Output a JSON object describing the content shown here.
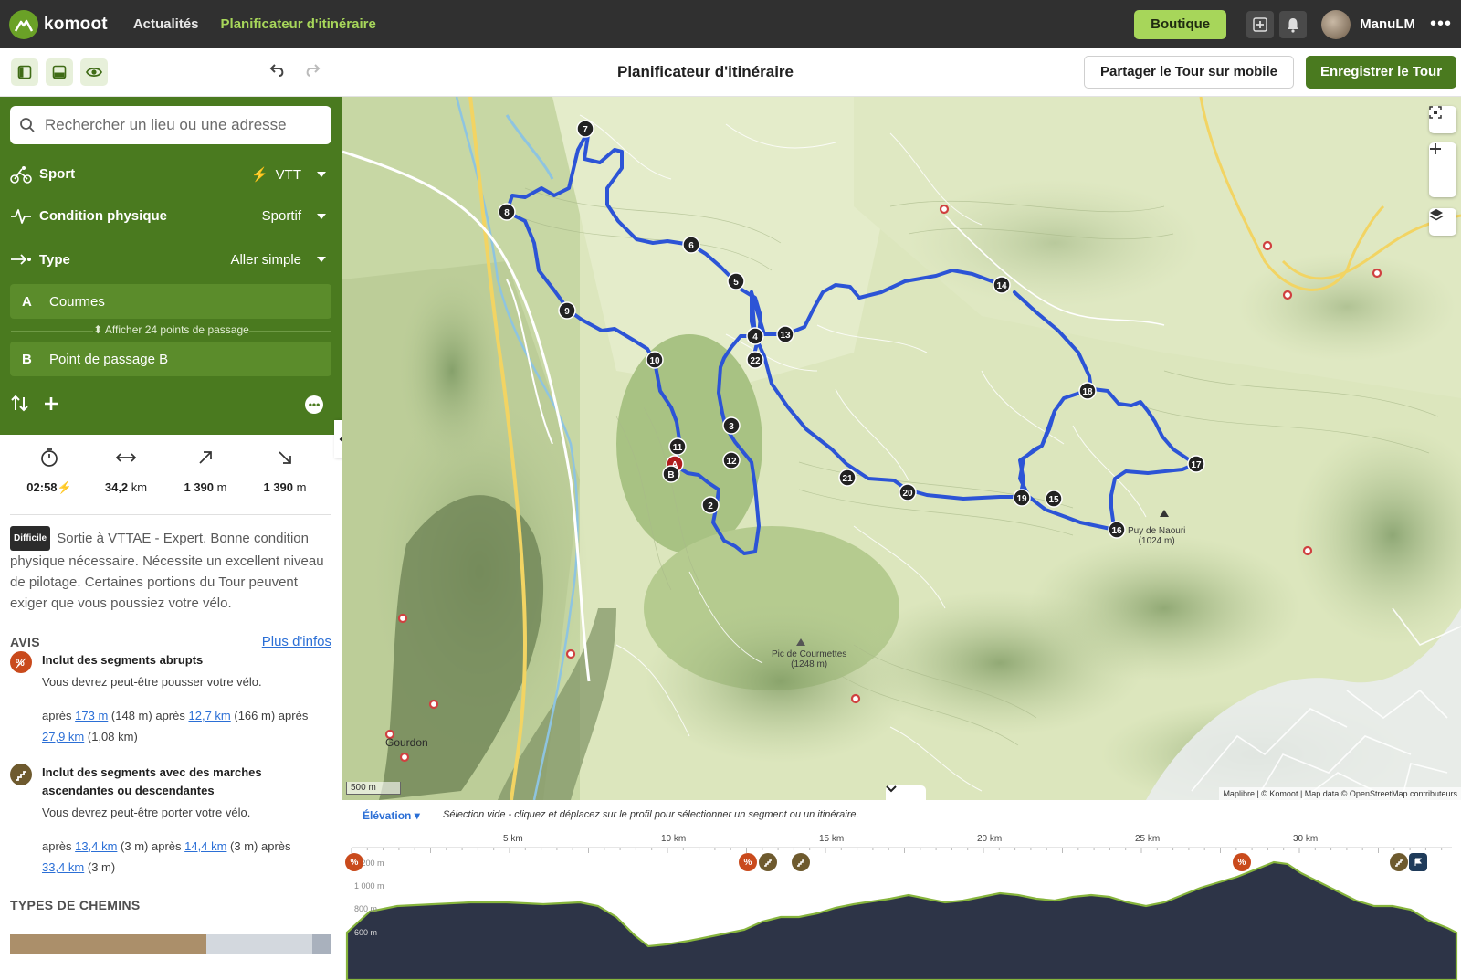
{
  "nav": {
    "logo_text": "komoot",
    "links": [
      "Actualités",
      "Planificateur d'itinéraire"
    ],
    "shop": "Boutique",
    "username": "ManuLM"
  },
  "toolbar": {
    "title": "Planificateur d'itinéraire",
    "share": "Partager le Tour sur mobile",
    "save": "Enregistrer le Tour"
  },
  "search": {
    "placeholder": "Rechercher un lieu ou une adresse"
  },
  "options": {
    "sport": {
      "label": "Sport",
      "value": "VTT"
    },
    "fitness": {
      "label": "Condition physique",
      "value": "Sportif"
    },
    "type": {
      "label": "Type",
      "value": "Aller simple"
    }
  },
  "waypoints": {
    "a": {
      "letter": "A",
      "name": "Courmes"
    },
    "show": "Afficher 24 points de passage",
    "b": {
      "letter": "B",
      "name": "Point de passage B"
    }
  },
  "stats": {
    "duration": "02:58",
    "distance": "34,2",
    "distance_unit": "km",
    "up": "1 390",
    "up_unit": "m",
    "down": "1 390",
    "down_unit": "m"
  },
  "difficulty": {
    "badge": "Difficile",
    "text": "Sortie à VTTAE - Expert. Bonne condition physique nécessaire. Nécessite un excellent niveau de pilotage. Certaines portions du Tour peuvent exiger que vous poussiez votre vélo."
  },
  "avis": {
    "heading": "AVIS",
    "more": "Plus d'infos",
    "warnings": [
      {
        "title": "Inclut des segments abrupts",
        "desc": "Vous devrez peut-être pousser votre vélo.",
        "segments": [
          {
            "prefix": "après",
            "link": "173 m",
            "extra": "(148 m)"
          },
          {
            "prefix": "après",
            "link": "12,7 km",
            "extra": "(166 m)"
          },
          {
            "prefix": "après",
            "link": "27,9 km",
            "extra": "(1,08 km)"
          }
        ]
      },
      {
        "title": "Inclut des segments avec des marches ascendantes ou descendantes",
        "desc": "Vous devrez peut-être porter votre vélo.",
        "segments": [
          {
            "prefix": "après",
            "link": "13,4 km",
            "extra": "(3 m)"
          },
          {
            "prefix": "après",
            "link": "14,4 km",
            "extra": "(3 m)"
          },
          {
            "prefix": "après",
            "link": "33,4 km",
            "extra": "(3 m)"
          }
        ]
      }
    ]
  },
  "path_types": {
    "heading": "TYPES DE CHEMINS",
    "shares": [
      0.61,
      0.33,
      0.06
    ],
    "colors": [
      "#ab8f6a",
      "#d3d8de",
      "#a9b1bd"
    ]
  },
  "map": {
    "scale": "500 m",
    "attribution": "Maplibre | © Komoot | Map data © OpenStreetMap contributeurs",
    "peaks": [
      {
        "name": "Puy de Naouri",
        "alt": "(1024 m)"
      },
      {
        "name": "Pic de Courmettes",
        "alt": "(1248 m)"
      }
    ],
    "place": "Gourdon",
    "markers": [
      "7",
      "8",
      "6",
      "5",
      "9",
      "10",
      "4",
      "13",
      "22",
      "14",
      "3",
      "11",
      "12",
      "2",
      "21",
      "20",
      "19",
      "15",
      "16",
      "17",
      "18"
    ],
    "route_color": "#2c54d6"
  },
  "elevation": {
    "tab": "Élévation",
    "hint": "Sélection vide - cliquez et déplacez sur le profil pour sélectionner un segment ou un itinéraire.",
    "km_ticks": [
      "5 km",
      "10 km",
      "15 km",
      "20 km",
      "25 km",
      "30 km"
    ],
    "alt_ticks": [
      "1 200 m",
      "1 000 m",
      "800 m",
      "600 m"
    ]
  }
}
